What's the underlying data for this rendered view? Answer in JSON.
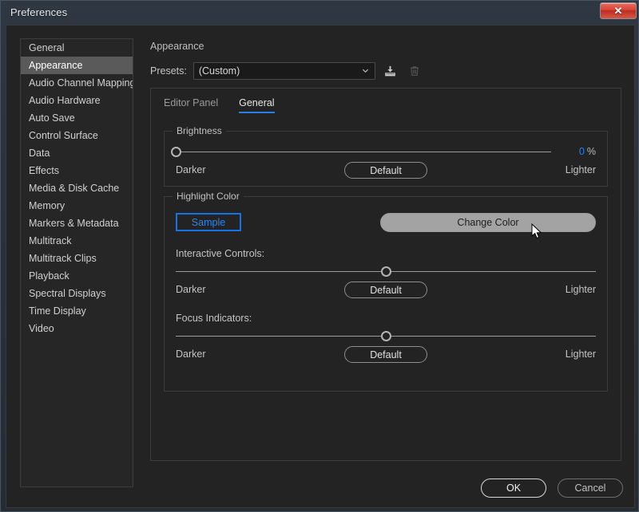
{
  "window": {
    "title": "Preferences",
    "close_icon": "close-icon",
    "close_glyph": "✕"
  },
  "sidebar": {
    "items": [
      {
        "label": "General",
        "selected": false
      },
      {
        "label": "Appearance",
        "selected": true
      },
      {
        "label": "Audio Channel Mapping",
        "selected": false
      },
      {
        "label": "Audio Hardware",
        "selected": false
      },
      {
        "label": "Auto Save",
        "selected": false
      },
      {
        "label": "Control Surface",
        "selected": false
      },
      {
        "label": "Data",
        "selected": false
      },
      {
        "label": "Effects",
        "selected": false
      },
      {
        "label": "Media & Disk Cache",
        "selected": false
      },
      {
        "label": "Memory",
        "selected": false
      },
      {
        "label": "Markers & Metadata",
        "selected": false
      },
      {
        "label": "Multitrack",
        "selected": false
      },
      {
        "label": "Multitrack Clips",
        "selected": false
      },
      {
        "label": "Playback",
        "selected": false
      },
      {
        "label": "Spectral Displays",
        "selected": false
      },
      {
        "label": "Time Display",
        "selected": false
      },
      {
        "label": "Video",
        "selected": false
      }
    ]
  },
  "panel": {
    "title": "Appearance",
    "presets": {
      "label": "Presets:",
      "value": "(Custom)",
      "caret_icon": "chevron-down-icon",
      "save_icon": "save-preset-icon",
      "delete_icon": "trash-icon"
    },
    "tabs": [
      {
        "label": "Editor Panel",
        "active": false
      },
      {
        "label": "General",
        "active": true
      }
    ],
    "brightness": {
      "legend": "Brightness",
      "value_number": "0",
      "value_unit": "%",
      "slider_position_pct": 0,
      "darker_label": "Darker",
      "lighter_label": "Lighter",
      "default_label": "Default"
    },
    "highlight_color": {
      "legend": "Highlight Color",
      "sample_label": "Sample",
      "change_color_label": "Change Color",
      "interactive_controls": {
        "label": "Interactive Controls:",
        "slider_position_pct": 50,
        "darker_label": "Darker",
        "lighter_label": "Lighter",
        "default_label": "Default"
      },
      "focus_indicators": {
        "label": "Focus Indicators:",
        "slider_position_pct": 50,
        "darker_label": "Darker",
        "lighter_label": "Lighter",
        "default_label": "Default"
      }
    }
  },
  "footer": {
    "ok_label": "OK",
    "cancel_label": "Cancel"
  },
  "colors": {
    "accent_blue": "#2680eb",
    "sample_border": "#1473e6",
    "selection_gray": "#5a5a5a",
    "close_red": "#d8483a",
    "hover_button": "#a3a3a3"
  }
}
